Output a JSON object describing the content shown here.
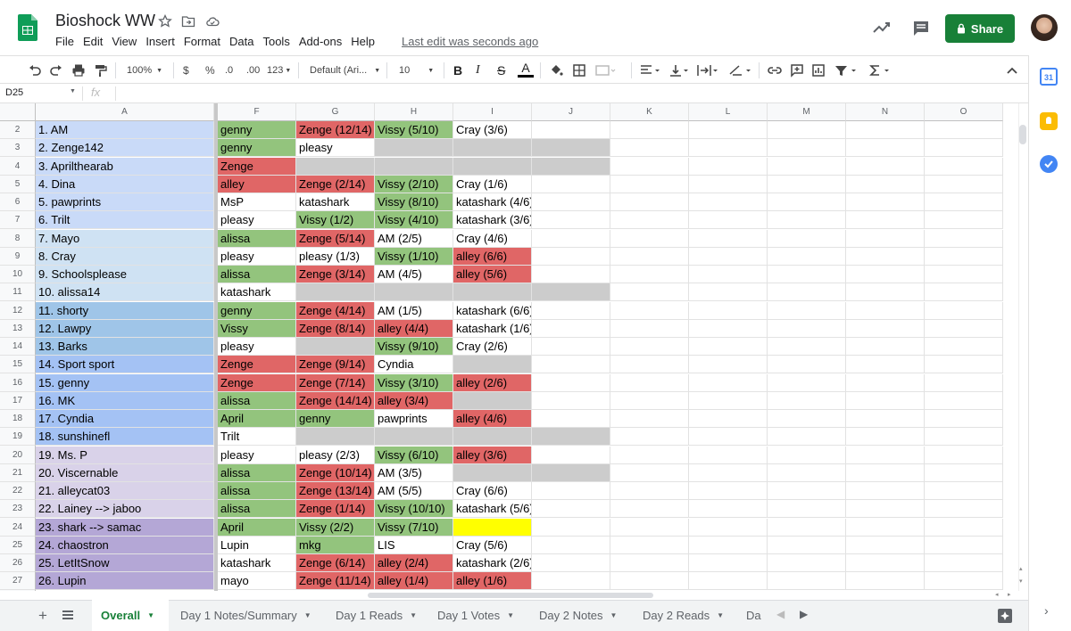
{
  "doc": {
    "title": "Bioshock WW",
    "last_edit": "Last edit was seconds ago"
  },
  "menu": [
    "File",
    "Edit",
    "View",
    "Insert",
    "Format",
    "Data",
    "Tools",
    "Add-ons",
    "Help"
  ],
  "share_label": "Share",
  "toolbar": {
    "zoom": "100%",
    "currency": "$",
    "percent": "%",
    "dec_less": ".0",
    "dec_more": ".00",
    "more_formats": "123",
    "font": "Default (Ari...",
    "font_size": "10"
  },
  "formula_bar": {
    "cell_ref": "D25",
    "fx": "fx"
  },
  "colors": {
    "green": "#93c47d",
    "red": "#e06666",
    "gray": "#cccccc",
    "yellow": "#ffff00",
    "share": "#188038"
  },
  "columns": [
    "A",
    "F",
    "G",
    "H",
    "I",
    "J",
    "K",
    "L",
    "M",
    "N",
    "O"
  ],
  "rows": [
    {
      "num": "2",
      "a": "1. AM",
      "a_color": "#c9daf8",
      "cells": [
        [
          "genny",
          "g"
        ],
        [
          "Zenge (12/14)",
          "r"
        ],
        [
          "Vissy (5/10)",
          "g"
        ],
        [
          "Cray (3/6)",
          ""
        ],
        [
          "",
          ""
        ]
      ]
    },
    {
      "num": "3",
      "a": "2. Zenge142",
      "a_color": "#c9daf8",
      "cells": [
        [
          "genny",
          "g"
        ],
        [
          "pleasy",
          ""
        ],
        [
          "",
          "x"
        ],
        [
          "",
          "x"
        ],
        [
          "",
          "x"
        ]
      ]
    },
    {
      "num": "4",
      "a": "3. Aprilthearab",
      "a_color": "#c9daf8",
      "cells": [
        [
          "Zenge",
          "r"
        ],
        [
          "",
          "x"
        ],
        [
          "",
          "x"
        ],
        [
          "",
          "x"
        ],
        [
          "",
          "x"
        ]
      ]
    },
    {
      "num": "5",
      "a": "4. Dina",
      "a_color": "#c9daf8",
      "cells": [
        [
          "alley",
          "r"
        ],
        [
          "Zenge (2/14)",
          "r"
        ],
        [
          "Vissy (2/10)",
          "g"
        ],
        [
          "Cray (1/6)",
          ""
        ],
        [
          "",
          ""
        ]
      ]
    },
    {
      "num": "6",
      "a": "5. pawprints",
      "a_color": "#c9daf8",
      "cells": [
        [
          "MsP",
          ""
        ],
        [
          "katashark",
          ""
        ],
        [
          "Vissy (8/10)",
          "g"
        ],
        [
          "katashark (4/6)",
          ""
        ],
        [
          "",
          ""
        ]
      ]
    },
    {
      "num": "7",
      "a": "6. Trilt",
      "a_color": "#c9daf8",
      "cells": [
        [
          "pleasy",
          ""
        ],
        [
          "Vissy (1/2)",
          "g"
        ],
        [
          "Vissy (4/10)",
          "g"
        ],
        [
          "katashark (3/6)",
          ""
        ],
        [
          "",
          ""
        ]
      ]
    },
    {
      "num": "8",
      "a": "7. Mayo",
      "a_color": "#cfe2f3",
      "cells": [
        [
          "alissa",
          "g"
        ],
        [
          "Zenge (5/14)",
          "r"
        ],
        [
          "AM (2/5)",
          ""
        ],
        [
          "Cray (4/6)",
          ""
        ],
        [
          "",
          ""
        ]
      ]
    },
    {
      "num": "9",
      "a": "8. Cray",
      "a_color": "#cfe2f3",
      "cells": [
        [
          "pleasy",
          ""
        ],
        [
          "pleasy (1/3)",
          ""
        ],
        [
          "Vissy (1/10)",
          "g"
        ],
        [
          "alley (6/6)",
          "r"
        ],
        [
          "",
          ""
        ]
      ]
    },
    {
      "num": "10",
      "a": "9. Schoolsplease",
      "a_color": "#cfe2f3",
      "cells": [
        [
          "alissa",
          "g"
        ],
        [
          "Zenge (3/14)",
          "r"
        ],
        [
          "AM (4/5)",
          ""
        ],
        [
          "alley (5/6)",
          "r"
        ],
        [
          "",
          ""
        ]
      ]
    },
    {
      "num": "11",
      "a": "10. alissa14",
      "a_color": "#cfe2f3",
      "cells": [
        [
          "katashark",
          ""
        ],
        [
          "",
          "x"
        ],
        [
          "",
          "x"
        ],
        [
          "",
          "x"
        ],
        [
          "",
          "x"
        ]
      ]
    },
    {
      "num": "12",
      "a": "11. shorty",
      "a_color": "#9fc5e8",
      "cells": [
        [
          "genny",
          "g"
        ],
        [
          "Zenge (4/14)",
          "r"
        ],
        [
          "AM (1/5)",
          ""
        ],
        [
          "katashark (6/6)",
          ""
        ],
        [
          "",
          ""
        ]
      ]
    },
    {
      "num": "13",
      "a": "12. Lawpy",
      "a_color": "#9fc5e8",
      "cells": [
        [
          "Vissy",
          "g"
        ],
        [
          "Zenge (8/14)",
          "r"
        ],
        [
          "alley (4/4)",
          "r"
        ],
        [
          "katashark (1/6)",
          ""
        ],
        [
          "",
          ""
        ]
      ]
    },
    {
      "num": "14",
      "a": "13. Barks",
      "a_color": "#9fc5e8",
      "cells": [
        [
          "pleasy",
          ""
        ],
        [
          "",
          "x"
        ],
        [
          "Vissy (9/10)",
          "g"
        ],
        [
          "Cray (2/6)",
          ""
        ],
        [
          "",
          ""
        ]
      ]
    },
    {
      "num": "15",
      "a": "14. Sport sport",
      "a_color": "#a4c2f4",
      "cells": [
        [
          "Zenge",
          "r"
        ],
        [
          "Zenge (9/14)",
          "r"
        ],
        [
          "Cyndia",
          ""
        ],
        [
          "",
          "x"
        ],
        [
          "",
          ""
        ]
      ]
    },
    {
      "num": "16",
      "a": "15. genny",
      "a_color": "#a4c2f4",
      "cells": [
        [
          "Zenge",
          "r"
        ],
        [
          "Zenge (7/14)",
          "r"
        ],
        [
          "Vissy (3/10)",
          "g"
        ],
        [
          "alley (2/6)",
          "r"
        ],
        [
          "",
          ""
        ]
      ]
    },
    {
      "num": "17",
      "a": "16. MK",
      "a_color": "#a4c2f4",
      "cells": [
        [
          "alissa",
          "g"
        ],
        [
          "Zenge (14/14)",
          "r"
        ],
        [
          "alley (3/4)",
          "r"
        ],
        [
          "",
          "x"
        ],
        [
          "",
          ""
        ]
      ]
    },
    {
      "num": "18",
      "a": "17. Cyndia",
      "a_color": "#a4c2f4",
      "cells": [
        [
          "April",
          "g"
        ],
        [
          "genny",
          "g"
        ],
        [
          "pawprints",
          ""
        ],
        [
          "alley (4/6)",
          "r"
        ],
        [
          "",
          ""
        ]
      ]
    },
    {
      "num": "19",
      "a": "18. sunshinefl",
      "a_color": "#a4c2f4",
      "cells": [
        [
          "Trilt",
          ""
        ],
        [
          "",
          "x"
        ],
        [
          "",
          "x"
        ],
        [
          "",
          "x"
        ],
        [
          "",
          "x"
        ]
      ]
    },
    {
      "num": "20",
      "a": "19. Ms. P",
      "a_color": "#d9d2e9",
      "cells": [
        [
          "pleasy",
          ""
        ],
        [
          "pleasy (2/3)",
          ""
        ],
        [
          "Vissy (6/10)",
          "g"
        ],
        [
          "alley (3/6)",
          "r"
        ],
        [
          "",
          ""
        ]
      ]
    },
    {
      "num": "21",
      "a": "20. Viscernable",
      "a_color": "#d9d2e9",
      "cells": [
        [
          "alissa",
          "g"
        ],
        [
          "Zenge (10/14)",
          "r"
        ],
        [
          "AM (3/5)",
          ""
        ],
        [
          "",
          "x"
        ],
        [
          "",
          "x"
        ]
      ]
    },
    {
      "num": "22",
      "a": "21. alleycat03",
      "a_color": "#d9d2e9",
      "cells": [
        [
          "alissa",
          "g"
        ],
        [
          "Zenge (13/14)",
          "r"
        ],
        [
          "AM (5/5)",
          ""
        ],
        [
          "Cray (6/6)",
          ""
        ],
        [
          "",
          ""
        ]
      ]
    },
    {
      "num": "23",
      "a": "22. Lainey --> jaboo",
      "a_color": "#d9d2e9",
      "cells": [
        [
          "alissa",
          "g"
        ],
        [
          "Zenge (1/14)",
          "r"
        ],
        [
          "Vissy (10/10)",
          "g"
        ],
        [
          "katashark (5/6)",
          ""
        ],
        [
          "",
          ""
        ]
      ]
    },
    {
      "num": "24",
      "a": "23. shark --> samac",
      "a_color": "#b4a7d6",
      "cells": [
        [
          "April",
          "g"
        ],
        [
          "Vissy (2/2)",
          "g"
        ],
        [
          "Vissy (7/10)",
          "g"
        ],
        [
          "",
          "y"
        ],
        [
          "",
          ""
        ]
      ]
    },
    {
      "num": "25",
      "a": "24. chaostron",
      "a_color": "#b4a7d6",
      "cells": [
        [
          "Lupin",
          ""
        ],
        [
          "mkg",
          "g"
        ],
        [
          "LIS",
          ""
        ],
        [
          "Cray (5/6)",
          ""
        ],
        [
          "",
          ""
        ]
      ]
    },
    {
      "num": "26",
      "a": "25. LetItSnow",
      "a_color": "#b4a7d6",
      "cells": [
        [
          "katashark",
          ""
        ],
        [
          "Zenge (6/14)",
          "r"
        ],
        [
          "alley (2/4)",
          "r"
        ],
        [
          "katashark (2/6)",
          ""
        ],
        [
          "",
          ""
        ]
      ]
    },
    {
      "num": "27",
      "a": "26. Lupin",
      "a_color": "#b4a7d6",
      "cells": [
        [
          "mayo",
          ""
        ],
        [
          "Zenge (11/14)",
          "r"
        ],
        [
          "alley (1/4)",
          "r"
        ],
        [
          "alley (1/6)",
          "r"
        ],
        [
          "",
          ""
        ]
      ]
    }
  ],
  "tabs": [
    "Overall",
    "Day 1 Notes/Summary",
    "Day 1 Reads",
    "Day 1 Votes",
    "Day 2 Notes",
    "Day 2 Reads",
    "Da"
  ]
}
